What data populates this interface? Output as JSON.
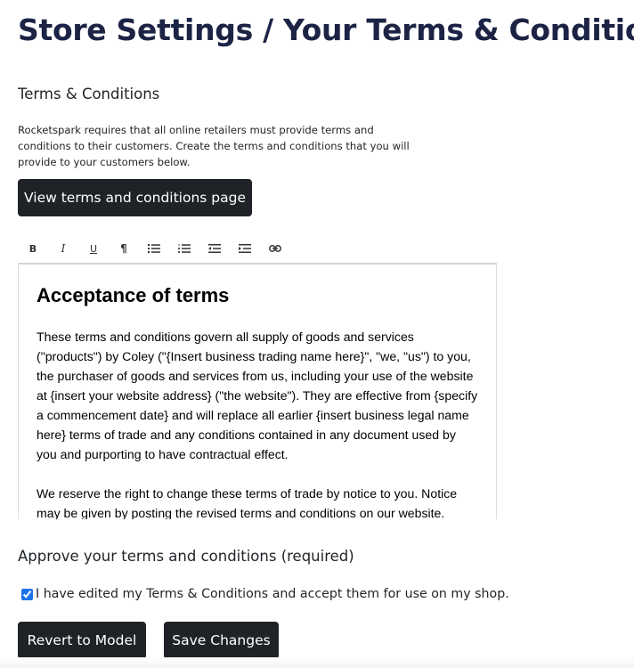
{
  "header": {
    "title": "Store Settings / Your Terms & Conditions"
  },
  "terms_section": {
    "title": "Terms & Conditions",
    "intro": "Rocketspark requires that all online retailers must provide terms and conditions to their customers. Create the terms and conditions that you will provide to your customers below.",
    "view_button_label": "View terms and conditions page"
  },
  "toolbar": {
    "buttons": [
      {
        "name": "bold",
        "glyph": "B"
      },
      {
        "name": "italic",
        "glyph": "I"
      },
      {
        "name": "underline",
        "glyph": "U"
      },
      {
        "name": "paragraph",
        "glyph": "¶"
      },
      {
        "name": "bulleted-list",
        "glyph": ""
      },
      {
        "name": "numbered-list",
        "glyph": ""
      },
      {
        "name": "outdent",
        "glyph": ""
      },
      {
        "name": "indent",
        "glyph": ""
      },
      {
        "name": "link",
        "glyph": ""
      }
    ]
  },
  "editor": {
    "heading": "Acceptance of terms",
    "paragraphs": [
      "These terms and conditions govern all supply of goods and services (\"products\") by Coley (\"{Insert business trading name here}\", \"we, \"us\") to you, the purchaser of goods and services from us, including your use of the website at {insert your website address} (\"the website\"). They are effective from {specify a commencement date} and will replace all earlier {insert business legal name here} terms of trade and any conditions contained in any document used by you and purporting to have contractual effect.",
      "We reserve the right to change these terms of trade by notice to you. Notice may be given by posting the revised terms and conditions on our website."
    ]
  },
  "approve_section": {
    "title": "Approve your terms and conditions (required)",
    "checkbox_label": "I have edited my Terms & Conditions and accept them for use on my shop.",
    "checkbox_checked": true
  },
  "actions": {
    "revert_label": "Revert to Model",
    "save_label": "Save Changes"
  },
  "colors": {
    "title": "#1c2345",
    "button_bg": "#1f2327",
    "checkbox_accent": "#1a73e8"
  }
}
